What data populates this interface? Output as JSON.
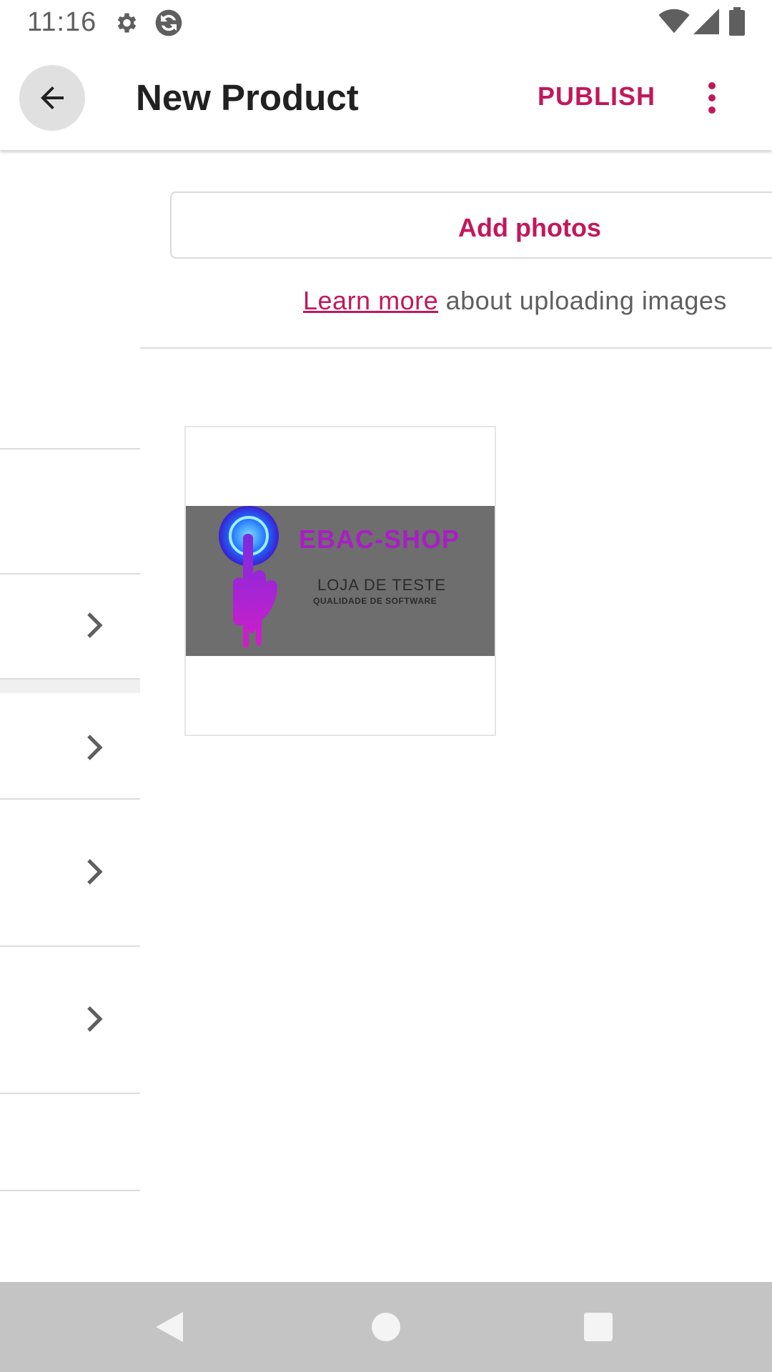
{
  "status_bar": {
    "time": "11:16",
    "icons": [
      "gear-icon",
      "sync-icon",
      "wifi-icon",
      "signal-icon",
      "battery-icon"
    ]
  },
  "app_bar": {
    "title": "New Product",
    "publish_label": "PUBLISH",
    "back_icon": "arrow-back-icon",
    "overflow_icon": "more-vertical-icon"
  },
  "photos": {
    "add_label": "Add photos",
    "learn_link": "Learn more",
    "learn_text": " about uploading images",
    "thumbnail": {
      "title": "EBAC-SHOP",
      "subtitle": "LOJA DE TESTE",
      "tagline": "QUALIDADE DE SOFTWARE"
    }
  },
  "nav_bar": {
    "icons": [
      "nav-back-icon",
      "nav-home-icon",
      "nav-recents-icon"
    ]
  },
  "colors": {
    "accent": "#c2185b",
    "text_primary": "#212121",
    "text_secondary": "#5f5f5f",
    "nav_bar_bg": "#c4c4c4"
  }
}
